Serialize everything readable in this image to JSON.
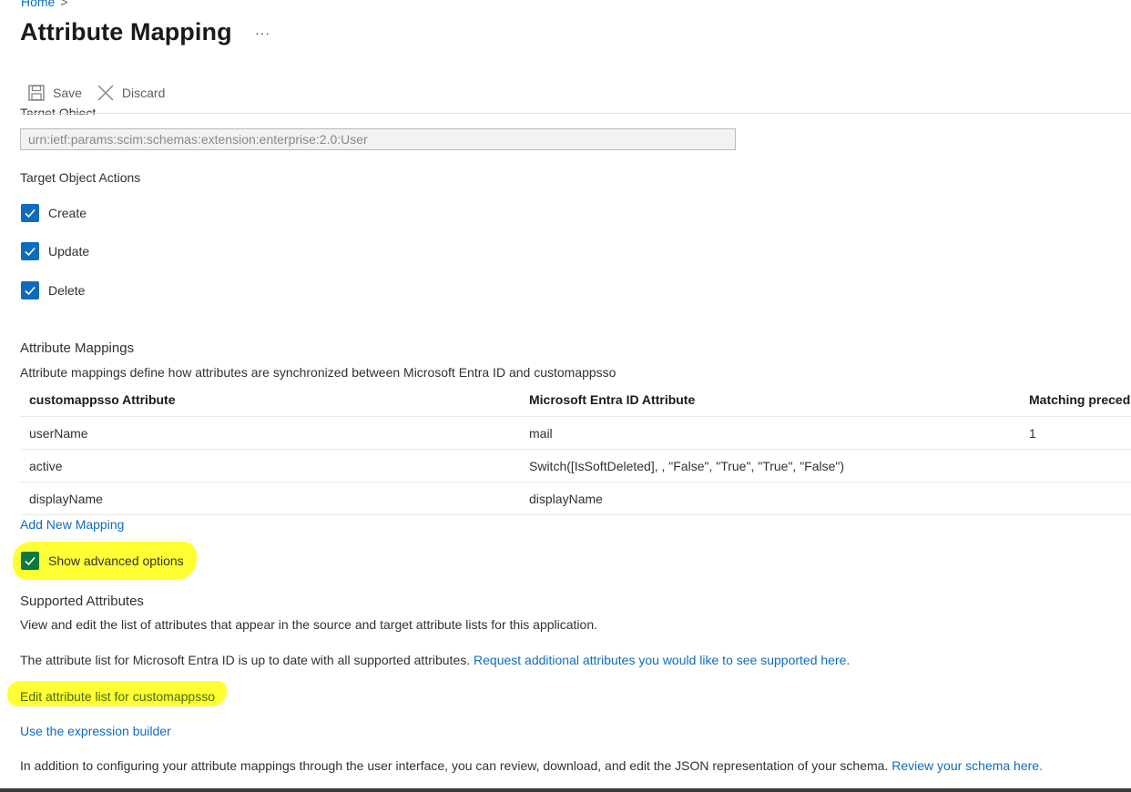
{
  "breadcrumb": {
    "home": "Home",
    "separator": ">"
  },
  "page": {
    "title": "Attribute Mapping",
    "more": "···"
  },
  "toolbar": {
    "save_label": "Save",
    "discard_label": "Discard"
  },
  "target_object": {
    "label": "Target Object",
    "value": "urn:ietf:params:scim:schemas:extension:enterprise:2.0:User"
  },
  "target_actions": {
    "label": "Target Object Actions",
    "items": [
      {
        "label": "Create",
        "checked": true
      },
      {
        "label": "Update",
        "checked": true
      },
      {
        "label": "Delete",
        "checked": true
      }
    ]
  },
  "mappings": {
    "title": "Attribute Mappings",
    "description": "Attribute mappings define how attributes are synchronized between Microsoft Entra ID and customappsso",
    "columns": [
      "customappsso Attribute",
      "Microsoft Entra ID Attribute",
      "Matching preced"
    ],
    "rows": [
      [
        "userName",
        "mail",
        "1"
      ],
      [
        "active",
        "Switch([IsSoftDeleted], , \"False\", \"True\", \"True\", \"False\")",
        ""
      ],
      [
        "displayName",
        "displayName",
        ""
      ]
    ],
    "add_link": "Add New Mapping"
  },
  "advanced": {
    "label": "Show advanced options",
    "checked": true
  },
  "supported": {
    "title": "Supported Attributes",
    "description": "View and edit the list of attributes that appear in the source and target attribute lists for this application.",
    "uptodate_text": "The attribute list for Microsoft Entra ID is up to date with all supported attributes.",
    "request_link": "Request additional attributes you would like to see supported here.",
    "edit_link": "Edit attribute list for customappsso",
    "expression_link": "Use the expression builder",
    "json_text": "In addition to configuring your attribute mappings through the user interface, you can review, download, and edit the JSON representation of your schema.",
    "review_link": "Review your schema here."
  },
  "colors": {
    "accent": "#0f6cbd",
    "highlight": "#ffff33",
    "text": "#323130"
  },
  "icons": {
    "save": "save-icon",
    "discard": "close-icon",
    "check": "checkmark-icon"
  }
}
